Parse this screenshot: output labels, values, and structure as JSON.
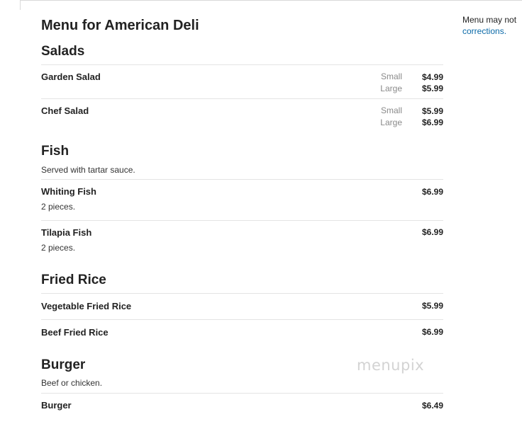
{
  "menu": {
    "title": "Menu for American Deli",
    "sections": [
      {
        "title": "Salads",
        "items": [
          {
            "name": "Garden Salad",
            "prices": [
              {
                "size": "Small",
                "price": "$4.99"
              },
              {
                "size": "Large",
                "price": "$5.99"
              }
            ]
          },
          {
            "name": "Chef Salad",
            "prices": [
              {
                "size": "Small",
                "price": "$5.99"
              },
              {
                "size": "Large",
                "price": "$6.99"
              }
            ]
          }
        ]
      },
      {
        "title": "Fish",
        "description": "Served with tartar sauce.",
        "items": [
          {
            "name": "Whiting Fish",
            "description": "2 pieces.",
            "price": "$6.99"
          },
          {
            "name": "Tilapia Fish",
            "description": "2 pieces.",
            "price": "$6.99"
          }
        ]
      },
      {
        "title": "Fried Rice",
        "items": [
          {
            "name": "Vegetable Fried Rice",
            "price": "$5.99"
          },
          {
            "name": "Beef Fried Rice",
            "price": "$6.99"
          }
        ]
      },
      {
        "title": "Burger",
        "description": "Beef or chicken.",
        "items": [
          {
            "name": "Burger",
            "price": "$6.49"
          }
        ]
      }
    ]
  },
  "sidebar": {
    "note_text": "Menu may not",
    "corrections_link": "corrections."
  },
  "watermark": "menupix",
  "colors": {
    "link": "#0b6aa8",
    "rule": "#e4e4e4",
    "size_label": "#8a8a8a"
  }
}
